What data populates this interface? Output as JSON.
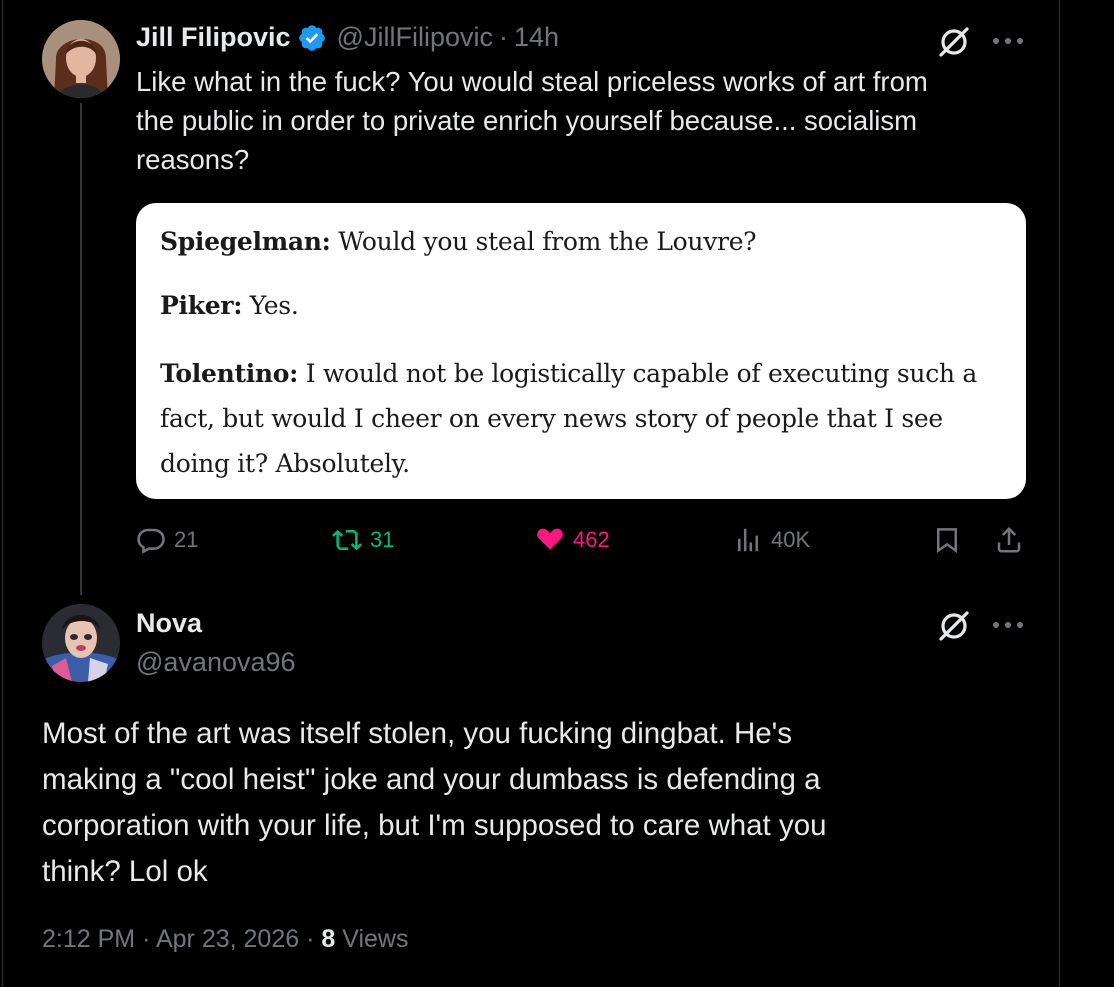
{
  "original_tweet": {
    "display_name": "Jill Filipovic",
    "handle": "@JillFilipovic",
    "separator": "·",
    "time_ago": "14h",
    "text_line1": "Like what in the fuck? You would steal priceless works of art from",
    "text_line2": "the public in order to private enrich yourself because... socialism",
    "text_line3": "reasons?",
    "quote": {
      "line1_speaker": "Spiegelman:",
      "line1_text": " Would you steal from the Louvre?",
      "line2_speaker": "Piker:",
      "line2_text": " Yes.",
      "line3_speaker": "Tolentino:",
      "line3_text": " I would not be logistically capable of executing such a",
      "line4_text": "fact, but would I cheer on every news story of people that I see",
      "line5_text": "doing it? Absolutely."
    },
    "stats": {
      "replies": "21",
      "retweets": "31",
      "likes": "462",
      "views": "40K"
    }
  },
  "reply_tweet": {
    "display_name": "Nova",
    "handle": "@avanova96",
    "text_line1": "Most of the art was itself stolen, you fucking dingbat. He's",
    "text_line2": "making a \"cool heist\" joke and your dumbass is defending a",
    "text_line3": "corporation with your life, but I'm supposed to care what you",
    "text_line4": "think? Lol ok",
    "time": "2:12 PM",
    "separator1": "·",
    "date": "Apr 23, 2026",
    "separator2": "·",
    "view_count": "8",
    "views_label": "Views"
  },
  "icons": {
    "verified": "verified-badge-icon",
    "grok": "grok-icon",
    "more": "more-icon",
    "reply": "reply-icon",
    "retweet": "retweet-icon",
    "like": "heart-icon",
    "views": "views-icon",
    "bookmark": "bookmark-icon",
    "share": "share-icon"
  },
  "colors": {
    "background": "#000000",
    "text": "#e7e9ea",
    "muted": "#71767b",
    "verified": "#1d9bf0",
    "retweet": "#00ba7c",
    "like": "#f91880"
  }
}
